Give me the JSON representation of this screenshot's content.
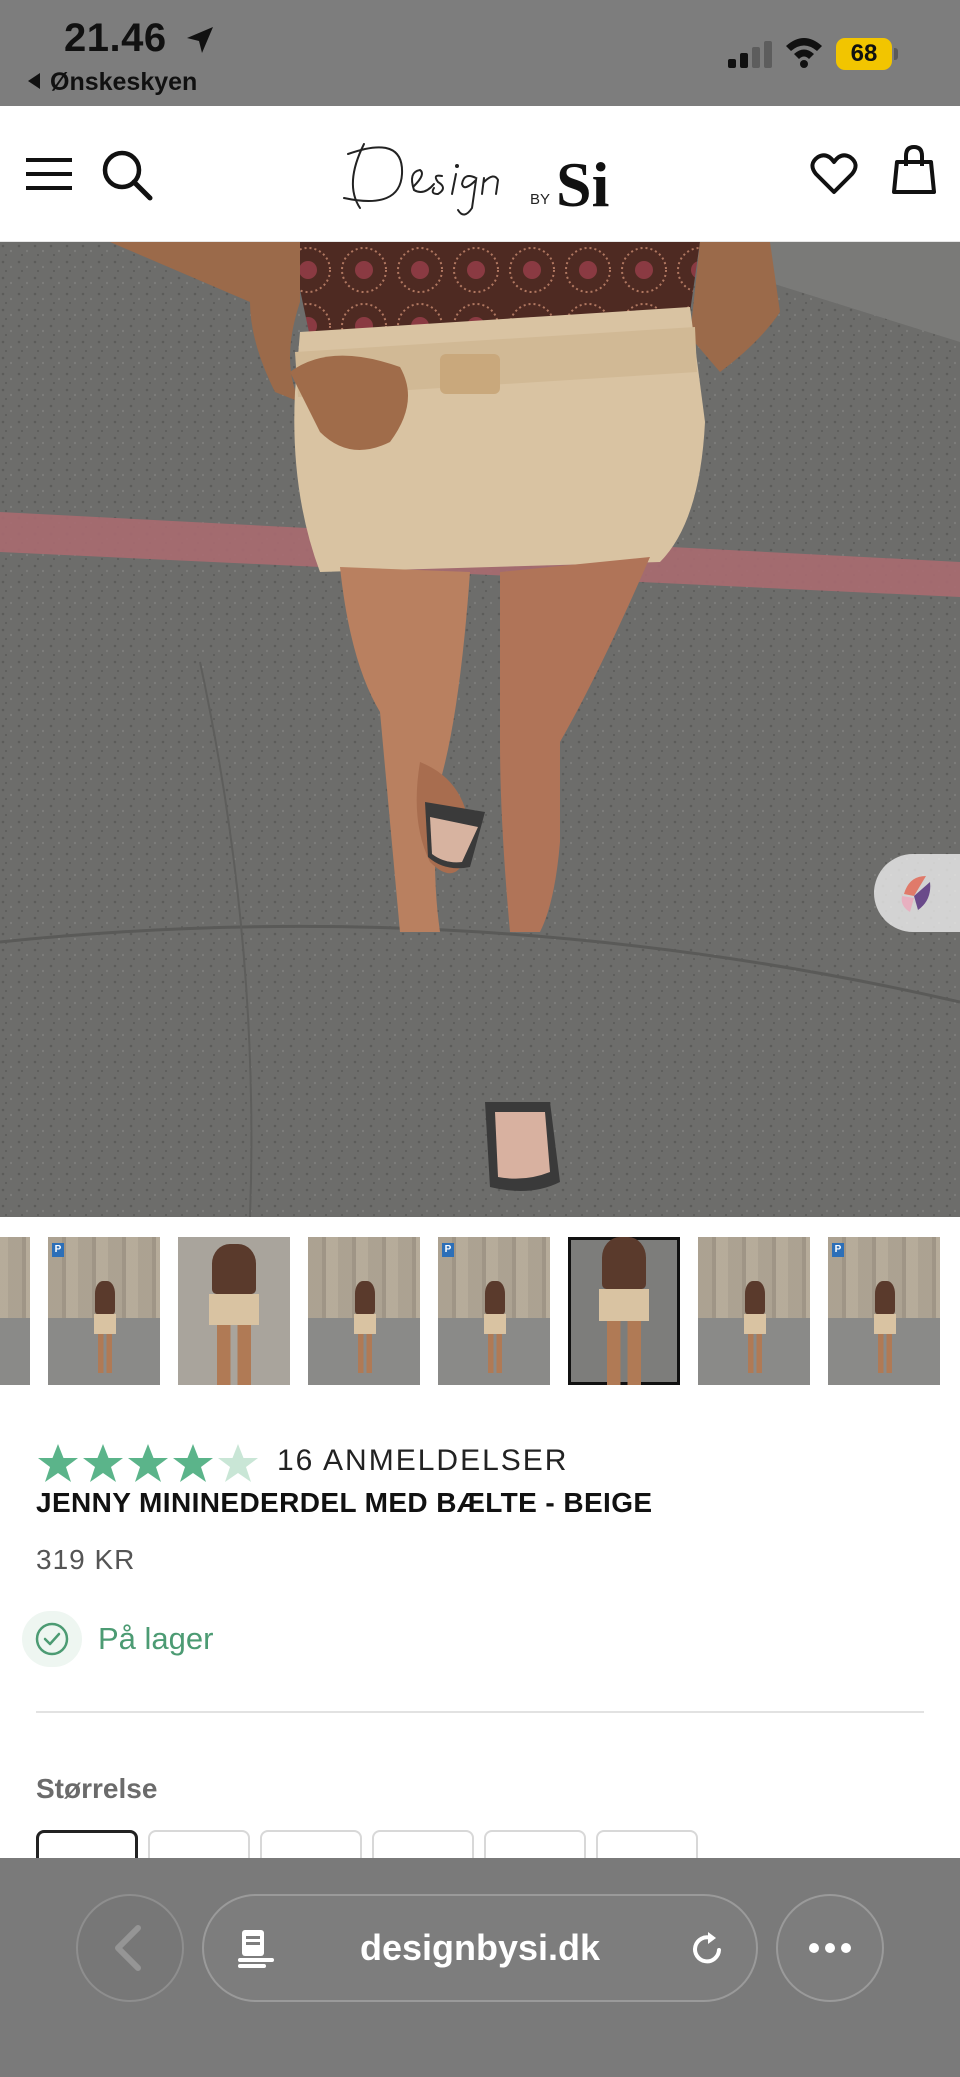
{
  "status_bar": {
    "time": "21.46",
    "back_app": "Ønskeskyen",
    "battery": "68"
  },
  "header": {
    "logo": "Design by Si",
    "icons": [
      "menu-icon",
      "search-icon",
      "heart-icon",
      "bag-icon"
    ]
  },
  "gallery": {
    "thumbnail_count": 8,
    "active_index": 5
  },
  "product": {
    "rating": 4.5,
    "reviews_label": "16 ANMELDELSER",
    "title": "JENNY MININEDERDEL MED BÆLTE - BEIGE",
    "price": "319 KR",
    "stock": "På lager",
    "size_label": "Størrelse"
  },
  "browser": {
    "url": "designbysi.dk"
  },
  "colors": {
    "star_green": "#5bb48a",
    "stock_green": "#4c9b73",
    "status_bar_bg": "#7d7d7d",
    "battery_yellow": "#f2c500"
  }
}
